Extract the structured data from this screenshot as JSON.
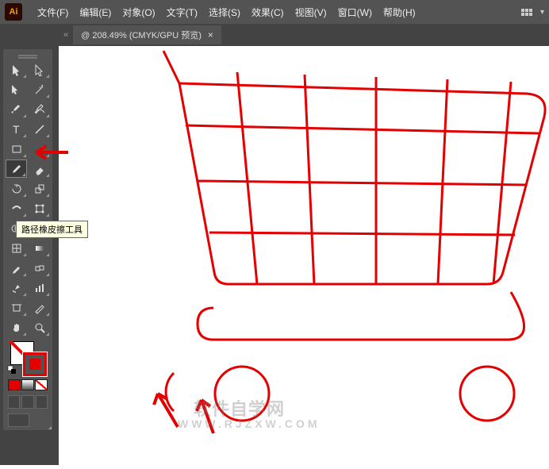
{
  "app": {
    "logo_text": "Ai"
  },
  "menu": {
    "items": [
      "文件(F)",
      "编辑(E)",
      "对象(O)",
      "文字(T)",
      "选择(S)",
      "效果(C)",
      "视图(V)",
      "窗口(W)",
      "帮助(H)"
    ]
  },
  "tab": {
    "label": "@ 208.49% (CMYK/GPU 预览)",
    "close": "×",
    "collapse": "«"
  },
  "tooltip": {
    "text": "路径橡皮擦工具"
  },
  "tools": [
    [
      "selection",
      "direct-selection"
    ],
    [
      "group-selection",
      "magic-wand"
    ],
    [
      "pen",
      "curvature"
    ],
    [
      "type",
      "line"
    ],
    [
      "rectangle",
      "paintbrush"
    ],
    [
      "pencil",
      "eraser"
    ],
    [
      "rotate",
      "scale"
    ],
    [
      "width",
      "free-transform"
    ],
    [
      "shape-builder",
      "perspective"
    ],
    [
      "mesh",
      "gradient"
    ],
    [
      "eyedropper",
      "blend"
    ],
    [
      "symbol-sprayer",
      "graph"
    ],
    [
      "artboard",
      "slice"
    ],
    [
      "hand",
      "zoom"
    ]
  ],
  "colors": {
    "fill": "none",
    "stroke": "#e40000",
    "mini": [
      "#e40000",
      "linear-gradient(#fff,#555)",
      "none"
    ]
  },
  "watermark": {
    "line1": "软件自学网",
    "line2": "WWW.RJZXW.COM"
  }
}
